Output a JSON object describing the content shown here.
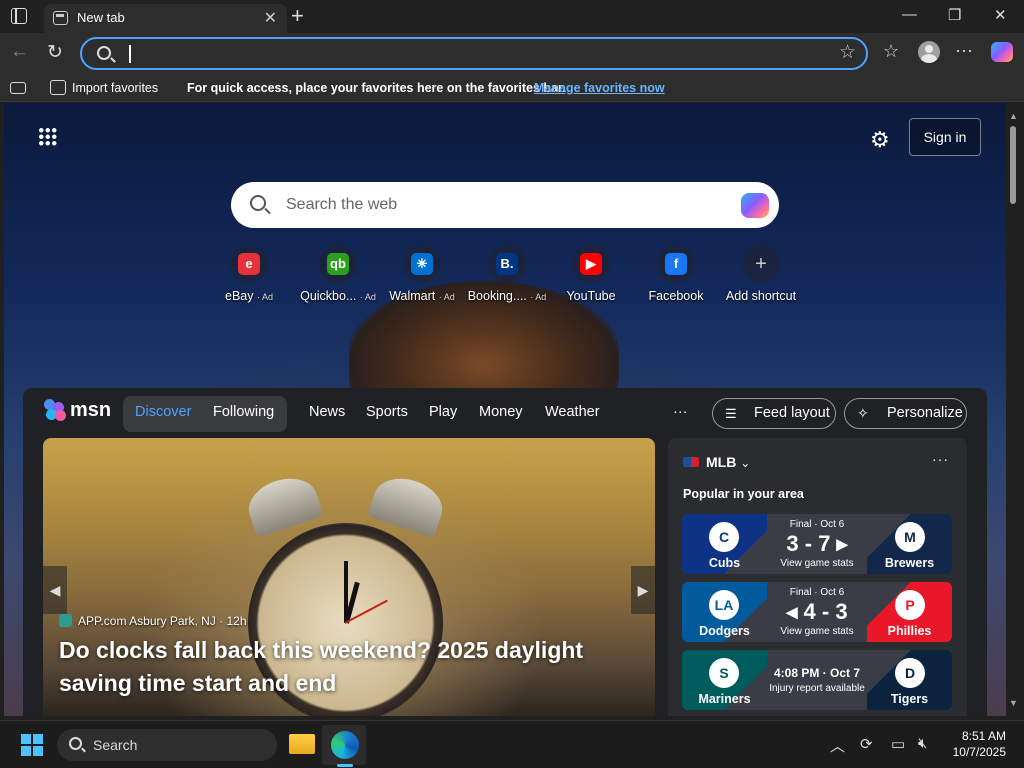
{
  "browser": {
    "tab_title": "New tab",
    "newtab_glyph": "+",
    "close_glyph": "✕",
    "controls": {
      "minimize": "—",
      "maximize": "❐",
      "close": "✕"
    },
    "toolbar": {
      "back": "←",
      "refresh": "↻",
      "star": "☆",
      "favorites": "☆",
      "more": "···"
    }
  },
  "favbar": {
    "import_label": "Import favorites",
    "prompt": "For quick access, place your favorites here on the favorites bar.",
    "manage_link": "Manage favorites now"
  },
  "ntp": {
    "gear": "⚙",
    "signin": "Sign in",
    "search_placeholder": "Search the web",
    "shortcuts": [
      {
        "label": "eBay",
        "ad": "· Ad",
        "glyph": "e",
        "color": "#e53238"
      },
      {
        "label": "Quickbo...",
        "ad": "· Ad",
        "glyph": "qb",
        "color": "#2ca01c"
      },
      {
        "label": "Walmart",
        "ad": "· Ad",
        "glyph": "✳",
        "color": "#0071ce"
      },
      {
        "label": "Booking....",
        "ad": "· Ad",
        "glyph": "B.",
        "color": "#003580"
      },
      {
        "label": "YouTube",
        "ad": "",
        "glyph": "▶",
        "color": "#ff0000"
      },
      {
        "label": "Facebook",
        "ad": "",
        "glyph": "f",
        "color": "#1877f2"
      },
      {
        "label": "Add shortcut",
        "ad": "",
        "glyph": "+",
        "color": "transparent"
      }
    ]
  },
  "feed": {
    "brand": "msn",
    "segments": {
      "active": "Discover",
      "inactive": "Following"
    },
    "nav": [
      "News",
      "Sports",
      "Play",
      "Money",
      "Weather"
    ],
    "more": "···",
    "feed_layout": "Feed layout",
    "personalize": "Personalize",
    "hero": {
      "source": "APP.com Asbury Park, NJ · 12h",
      "title": "Do clocks fall back this weekend? 2025 daylight saving time start and end",
      "prev": "◀",
      "next": "▶"
    },
    "sidebar": {
      "league": "MLB",
      "chevron": "⌄",
      "more": "···",
      "subtitle": "Popular in your area",
      "games": [
        {
          "status": "Final · Oct 6",
          "score": "3 - 7 ▸",
          "link": "View game stats",
          "team_a": "Cubs",
          "team_b": "Brewers",
          "logo_a": "C",
          "logo_b": "M",
          "color_a": "#0e3386",
          "color_b": "#12284b"
        },
        {
          "status": "Final · Oct 6",
          "score": "◂ 4 - 3",
          "link": "View game stats",
          "team_a": "Dodgers",
          "team_b": "Phillies",
          "logo_a": "LA",
          "logo_b": "P",
          "color_a": "#005a9c",
          "color_b": "#e81828"
        },
        {
          "status": "4:08 PM · Oct 7",
          "score": "",
          "link": "Injury report available",
          "team_a": "Mariners",
          "team_b": "Tigers",
          "logo_a": "S",
          "logo_b": "D",
          "color_a": "#005c5c",
          "color_b": "#0c2340"
        }
      ]
    }
  },
  "taskbar": {
    "search": "Search",
    "time": "8:51 AM",
    "date": "10/7/2025",
    "tray_up": "︿"
  }
}
